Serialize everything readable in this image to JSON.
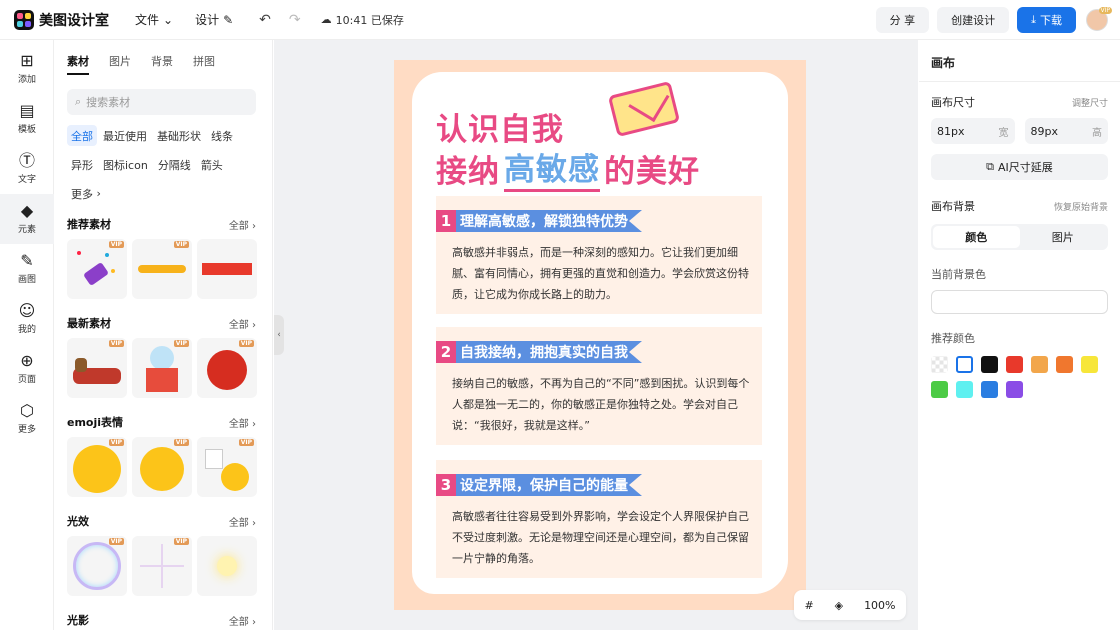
{
  "topbar": {
    "app_name": "美图设计室",
    "file_menu": "文件",
    "design_menu": "设计",
    "save_status": "10:41 已保存",
    "share": "分 享",
    "create": "创建设计",
    "download": "下载",
    "avatar_badge": "VIP"
  },
  "leftrail": [
    {
      "label": "添加",
      "icon": "plus-square-icon"
    },
    {
      "label": "模板",
      "icon": "template-icon"
    },
    {
      "label": "文字",
      "icon": "text-icon"
    },
    {
      "label": "元素",
      "icon": "shapes-icon"
    },
    {
      "label": "画图",
      "icon": "draw-icon"
    },
    {
      "label": "我的",
      "icon": "user-icon"
    },
    {
      "label": "页面",
      "icon": "page-add-icon"
    },
    {
      "label": "更多",
      "icon": "cube-icon"
    }
  ],
  "panel": {
    "tabs": [
      "素材",
      "图片",
      "背景",
      "拼图"
    ],
    "search_placeholder": "搜索素材",
    "chips": [
      "全部",
      "最近使用",
      "基础形状",
      "线条",
      "异形",
      "图标icon",
      "分隔线",
      "箭头",
      "更多"
    ],
    "sections": [
      {
        "title": "推荐素材",
        "all": "全部"
      },
      {
        "title": "最新素材",
        "all": "全部"
      },
      {
        "title": "emoji表情",
        "all": "全部"
      },
      {
        "title": "光效",
        "all": "全部"
      },
      {
        "title": "光影",
        "all": "全部"
      }
    ],
    "vip": "VIP"
  },
  "artboard": {
    "title_line1": "认识自我",
    "title_line2_a": "接纳",
    "title_line2_highlight": "高敏感",
    "title_line2_b": "的美好",
    "sections": [
      {
        "num": "1",
        "heading": "理解高敏感，解锁独特优势",
        "body": "高敏感并非弱点，而是一种深刻的感知力。它让我们更加细腻、富有同情心，拥有更强的直觉和创造力。学会欣赏这份特质，让它成为你成长路上的助力。"
      },
      {
        "num": "2",
        "heading": "自我接纳，拥抱真实的自我",
        "body": "接纳自己的敏感，不再为自己的“不同”感到困扰。认识到每个人都是独一无二的，你的敏感正是你独特之处。学会对自己说：“我很好，我就是这样。”"
      },
      {
        "num": "3",
        "heading": "设定界限，保护自己的能量",
        "body": "高敏感者往往容易受到外界影响，学会设定个人界限保护自己不受过度刺激。无论是物理空间还是心理空间，都为自己保留一片宁静的角落。"
      }
    ]
  },
  "zoom": "100%",
  "rightpanel": {
    "title": "画布",
    "size_label": "画布尺寸",
    "size_adjust": "调整尺寸",
    "width_value": "81px",
    "width_unit": "宽",
    "height_value": "89px",
    "height_unit": "高",
    "ai_extend": "AI尺寸延展",
    "bg_label": "画布背景",
    "bg_restore": "恢复原始背景",
    "seg_color": "颜色",
    "seg_image": "图片",
    "current_bg": "当前背景色",
    "recommend": "推荐颜色",
    "swatches": [
      "transparent",
      "#ffffff",
      "#111111",
      "#e8392b",
      "#f2a64b",
      "#f0772e",
      "#f7e63a",
      "#4ccb45",
      "#5ff0f0",
      "#2a7de1",
      "#8a4de6"
    ]
  }
}
